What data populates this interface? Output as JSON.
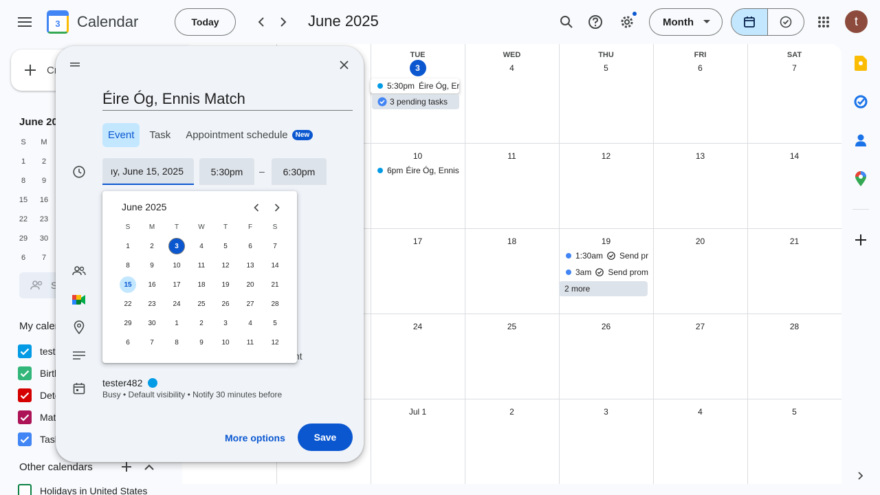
{
  "header": {
    "app_name": "Calendar",
    "logo_number": "3",
    "today_label": "Today",
    "month_title": "June 2025",
    "view_select": "Month",
    "avatar_letter": "t"
  },
  "sidebar": {
    "create_label": "Cr",
    "mini_month_label": "June 20",
    "mini_dow": [
      "S",
      "M"
    ],
    "mini_rows": [
      [
        "1",
        "2"
      ],
      [
        "8",
        "9"
      ],
      [
        "15",
        "16"
      ],
      [
        "22",
        "23"
      ],
      [
        "29",
        "30"
      ],
      [
        "6",
        "7"
      ]
    ],
    "search_people_placeholder": "S",
    "my_calendars_label": "My caler",
    "my_calendars": [
      {
        "name": "teste",
        "color": "#039be5"
      },
      {
        "name": "Birth",
        "color": "#33b679"
      },
      {
        "name": "Dete",
        "color": "#d50000"
      },
      {
        "name": "Mat",
        "color": "#ad1457"
      },
      {
        "name": "Task",
        "color": "#4285f4"
      }
    ],
    "other_calendars_label": "Other calendars",
    "other_calendars": [
      {
        "name": "Holidays in United States",
        "color": "#0b8043"
      }
    ]
  },
  "grid": {
    "weekdays": [
      "",
      "",
      "TUE",
      "WED",
      "THU",
      "FRI",
      "SAT"
    ],
    "weeks": [
      [
        "",
        "",
        "3",
        "4",
        "5",
        "6",
        "7"
      ],
      [
        "",
        "",
        "10",
        "11",
        "12",
        "13",
        "14"
      ],
      [
        "",
        "",
        "17",
        "18",
        "19",
        "20",
        "21"
      ],
      [
        "",
        "",
        "24",
        "25",
        "26",
        "27",
        "28"
      ],
      [
        "",
        "",
        "Jul 1",
        "2",
        "3",
        "4",
        "5"
      ]
    ],
    "today": "3",
    "events": {
      "tue3_time": "5:30pm",
      "tue3_title": "Éire Óg, Er",
      "tue3_tasks": "3 pending tasks",
      "tue10_time": "6pm",
      "tue10_title": "Éire Óg, Ennis",
      "thu19_e1_time": "1:30am",
      "thu19_e1_title": "Send pr",
      "thu19_e2_time": "3am",
      "thu19_e2_title": "Send prom",
      "thu19_more": "2 more"
    }
  },
  "dialog": {
    "title": "Éire Óg, Ennis Match",
    "tabs": [
      "Event",
      "Task",
      "Appointment schedule"
    ],
    "new_badge": "New",
    "date": "ıy, June 15, 2025",
    "start_time": "5:30pm",
    "dash": "–",
    "end_time": "6:30pm",
    "partial_text": "nt",
    "owner": "tester482",
    "owner_details": "Busy • Default visibility • Notify 30 minutes before",
    "more_options": "More options",
    "save": "Save"
  },
  "datepicker": {
    "title": "June 2025",
    "dow": [
      "S",
      "M",
      "T",
      "W",
      "T",
      "F",
      "S"
    ],
    "weeks": [
      [
        "1",
        "2",
        "3",
        "4",
        "5",
        "6",
        "7"
      ],
      [
        "8",
        "9",
        "10",
        "11",
        "12",
        "13",
        "14"
      ],
      [
        "15",
        "16",
        "17",
        "18",
        "19",
        "20",
        "21"
      ],
      [
        "22",
        "23",
        "24",
        "25",
        "26",
        "27",
        "28"
      ],
      [
        "29",
        "30",
        "1",
        "2",
        "3",
        "4",
        "5"
      ],
      [
        "6",
        "7",
        "8",
        "9",
        "10",
        "11",
        "12"
      ]
    ],
    "today": "3",
    "selected": "15"
  },
  "colors": {
    "primary": "#0b57d0",
    "selected_bg": "#c2e7ff",
    "event_dot": "#039be5"
  }
}
